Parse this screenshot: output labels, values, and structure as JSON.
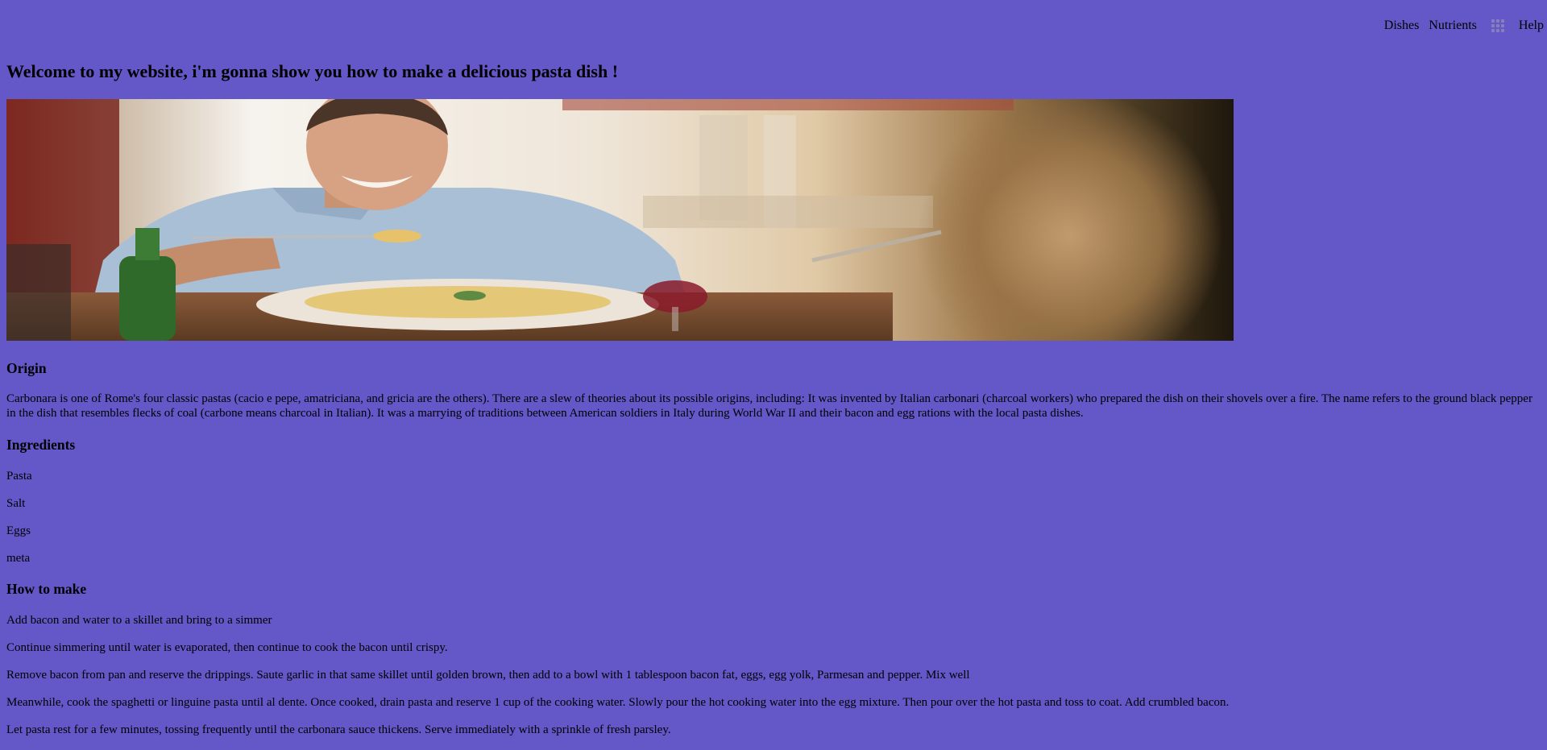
{
  "nav": {
    "dishes": "Dishes",
    "nutrients": "Nutrients",
    "apps_icon": "grid-apps-icon",
    "help": "Help"
  },
  "page": {
    "title": "Welcome to my website, i'm gonna show you how to make a delicious pasta dish !"
  },
  "hero": {
    "alt": "Smiling man at a restaurant table taking a forkful of pasta"
  },
  "origin": {
    "heading": "Origin",
    "text": "Carbonara is one of Rome's four classic pastas (cacio e pepe, amatriciana, and gricia are the others). There are a slew of theories about its possible origins, including: It was invented by Italian carbonari (charcoal workers) who prepared the dish on their shovels over a fire. The name refers to the ground black pepper in the dish that resembles flecks of coal (carbone means charcoal in Italian). It was a marrying of traditions between American soldiers in Italy during World War II and their bacon and egg rations with the local pasta dishes."
  },
  "ingredients": {
    "heading": "Ingredients",
    "items": [
      "Pasta",
      "Salt",
      "Eggs",
      "meta"
    ]
  },
  "how_to": {
    "heading": "How to make",
    "steps": [
      "Add bacon and water to a skillet and bring to a simmer",
      "Continue simmering until water is evaporated, then continue to cook the bacon until crispy.",
      "Remove bacon from pan and reserve the drippings. Saute garlic in that same skillet until golden brown, then add to a bowl with 1 tablespoon bacon fat, eggs, egg yolk, Parmesan and pepper. Mix well",
      "Meanwhile, cook the spaghetti or linguine pasta until al dente. Once cooked, drain pasta and reserve 1 cup of the cooking water. Slowly pour the hot cooking water into the egg mixture. Then pour over the hot pasta and toss to coat. Add crumbled bacon.",
      "Let pasta rest for a few minutes, tossing frequently until the carbonara sauce thickens. Serve immediately with a sprinkle of fresh parsley."
    ]
  },
  "colors": {
    "background": "#6457c8",
    "text": "#000000"
  }
}
